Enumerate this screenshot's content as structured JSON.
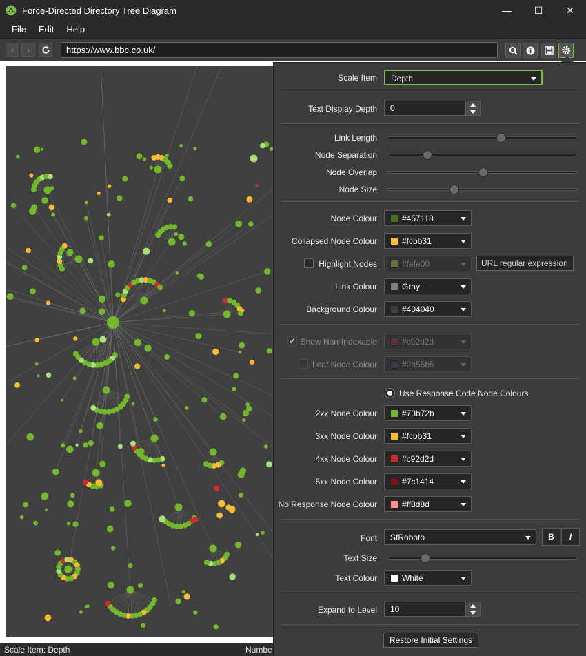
{
  "window": {
    "title": "Force-Directed Directory Tree Diagram",
    "controls": [
      "—",
      "☐",
      "✕"
    ]
  },
  "menu": [
    "File",
    "Edit",
    "Help"
  ],
  "toolbar": {
    "url": "https://www.bbc.co.uk/"
  },
  "status": {
    "left": "Scale Item: Depth",
    "right": "Numbe"
  },
  "colors": {
    "node": "#73b72b",
    "collapsed": "#fcbb31",
    "error": "#c92d2d",
    "canvas_bg": "#404040",
    "light_node": "#a8e07a"
  },
  "settings": {
    "scale_item": {
      "label": "Scale Item",
      "value": "Depth"
    },
    "text_display_depth": {
      "label": "Text Display Depth",
      "value": "0"
    },
    "sliders": [
      {
        "label": "Link Length",
        "value": 0.6
      },
      {
        "label": "Node Separation",
        "value": 0.19
      },
      {
        "label": "Node Overlap",
        "value": 0.5
      },
      {
        "label": "Node Size",
        "value": 0.34
      }
    ],
    "node_colour": {
      "label": "Node Colour",
      "value": "#457118",
      "swatch": "#457118"
    },
    "collapsed_node_colour": {
      "label": "Collapsed Node Colour",
      "value": "#fcbb31",
      "swatch": "#fcbb31"
    },
    "highlight_nodes": {
      "label": "Highlight Nodes",
      "value": "#fefe00",
      "swatch": "#6e6e3a",
      "placeholder": "URL regular expression"
    },
    "link_colour": {
      "label": "Link Colour",
      "value": "Gray",
      "swatch": "#808080"
    },
    "background_colour": {
      "label": "Background Colour",
      "value": "#404040",
      "swatch": "#404040"
    },
    "show_non_indexable": {
      "label": "Show Non-Indexable",
      "value": "#c92d2d",
      "swatch": "#5a3434"
    },
    "leaf_node_colour": {
      "label": "Leaf Node Colour",
      "value": "#2a55b5",
      "swatch": "#323a4c"
    },
    "use_response_code": {
      "label": "Use Response Code Node Colours"
    },
    "response_codes": [
      {
        "label": "2xx Node Colour",
        "value": "#73b72b",
        "swatch": "#73b72b"
      },
      {
        "label": "3xx Node Colour",
        "value": "#fcbb31",
        "swatch": "#fcbb31"
      },
      {
        "label": "4xx Node Colour",
        "value": "#c92d2d",
        "swatch": "#c92d2d"
      },
      {
        "label": "5xx Node Colour",
        "value": "#7c1414",
        "swatch": "#7c1414"
      },
      {
        "label": "No Response Node Colour",
        "value": "#ff8d8d",
        "swatch": "#ff8d8d"
      }
    ],
    "font": {
      "label": "Font",
      "value": "SfRoboto",
      "bold": "B",
      "italic": "I"
    },
    "text_size": {
      "label": "Text Size",
      "value": 0.18
    },
    "text_colour": {
      "label": "Text Colour",
      "value": "White",
      "swatch": "#ffffff"
    },
    "expand_to_level": {
      "label": "Expand to Level",
      "value": "10"
    },
    "restore_button": "Restore Initial Settings"
  }
}
